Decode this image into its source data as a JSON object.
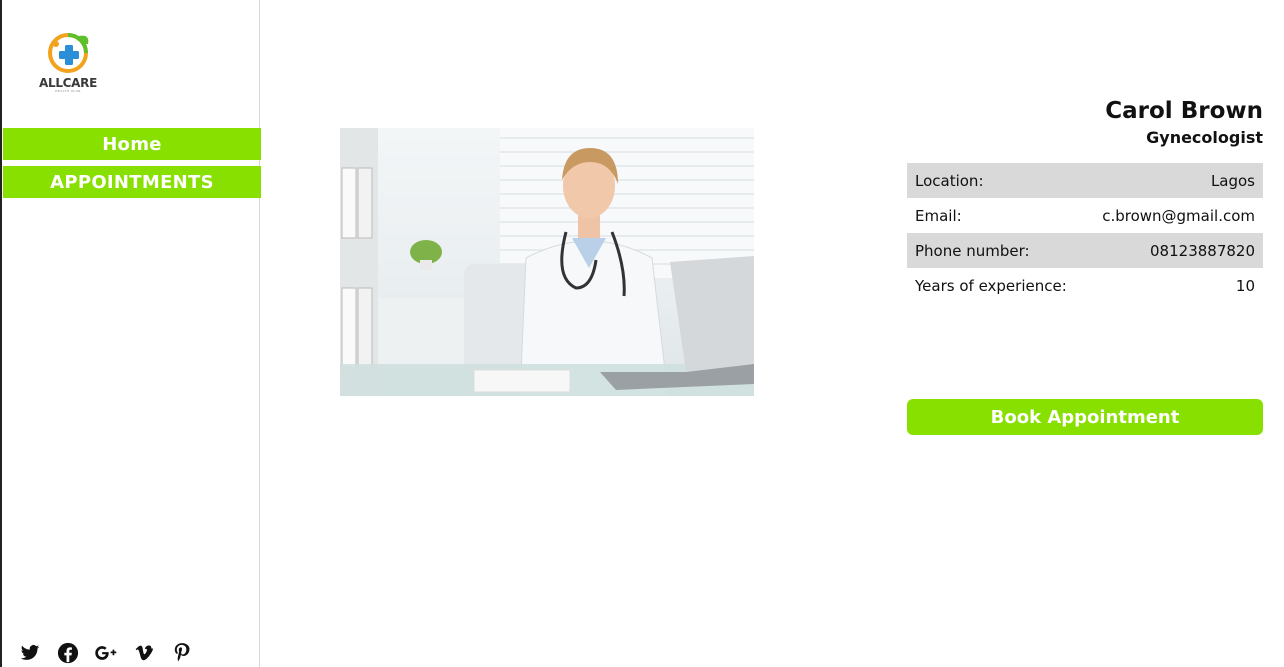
{
  "brand": {
    "name": "ALLCARE",
    "tagline": "HEALTH PLAN",
    "logo_icon": "medical-cross-leaf-icon"
  },
  "nav": {
    "items": [
      {
        "label": "Home"
      },
      {
        "label": "APPOINTMENTS"
      }
    ]
  },
  "social": [
    "twitter-icon",
    "facebook-icon",
    "google-plus-icon",
    "vimeo-icon",
    "pinterest-icon"
  ],
  "doctor": {
    "name": "Carol Brown",
    "specialty": "Gynecologist",
    "details": [
      {
        "label": "Location:",
        "value": "Lagos"
      },
      {
        "label": "Email:",
        "value": "c.brown@gmail.com"
      },
      {
        "label": "Phone number:",
        "value": "08123887820"
      },
      {
        "label": "Years of experience:",
        "value": "10"
      }
    ]
  },
  "actions": {
    "book_label": "Book Appointment"
  },
  "colors": {
    "accent": "#88e000",
    "row_shade": "#d9d9d9"
  }
}
